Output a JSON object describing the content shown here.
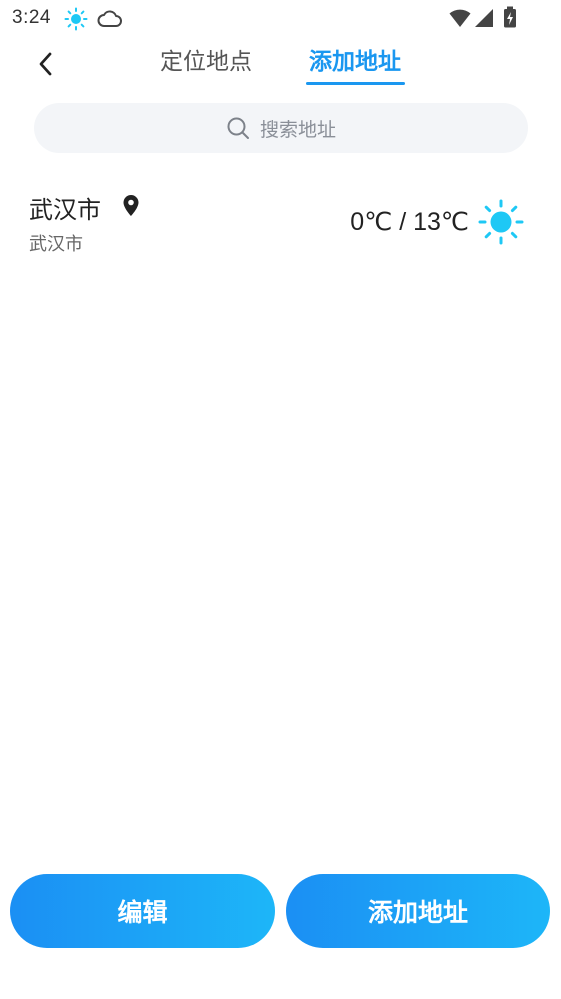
{
  "status_bar": {
    "time": "3:24",
    "icons": [
      "sun-icon",
      "cloud-icon",
      "wifi-icon",
      "signal-icon",
      "battery-charging-icon"
    ]
  },
  "header": {
    "back_icon": "chevron-left-icon",
    "tabs": [
      {
        "label": "定位地点",
        "active": false
      },
      {
        "label": "添加地址",
        "active": true
      }
    ]
  },
  "search": {
    "placeholder": "搜索地址",
    "icon": "search-icon"
  },
  "locations": [
    {
      "name": "武汉市",
      "subtitle": "武汉市",
      "is_current_location": true,
      "temp_range": "0℃ / 13℃",
      "weather_icon": "sunny-icon"
    }
  ],
  "footer": {
    "edit_label": "编辑",
    "add_label": "添加地址"
  },
  "colors": {
    "accent": "#1a97f0",
    "button_gradient_start": "#1b8ff4",
    "button_gradient_end": "#1db6f8",
    "sun_icon": "#1ec8f5",
    "search_bg": "#f3f5f8"
  }
}
